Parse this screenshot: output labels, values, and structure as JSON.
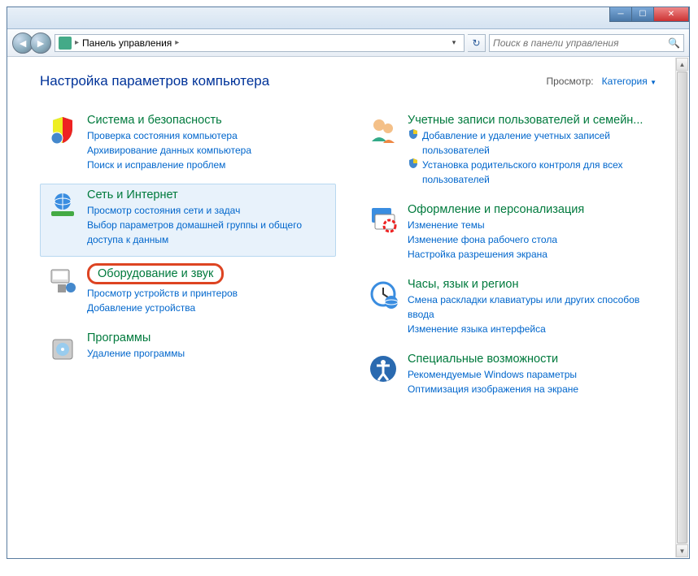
{
  "breadcrumb": {
    "root": "Панель управления"
  },
  "search": {
    "placeholder": "Поиск в панели управления"
  },
  "page_title": "Настройка параметров компьютера",
  "viewby": {
    "label": "Просмотр:",
    "value": "Категория"
  },
  "left": [
    {
      "title": "Система и безопасность",
      "links": [
        "Проверка состояния компьютера",
        "Архивирование данных компьютера",
        "Поиск и исправление проблем"
      ]
    },
    {
      "title": "Сеть и Интернет",
      "links": [
        "Просмотр состояния сети и задач",
        "Выбор параметров домашней группы и общего доступа к данным"
      ]
    },
    {
      "title": "Оборудование и звук",
      "links": [
        "Просмотр устройств и принтеров",
        "Добавление устройства"
      ]
    },
    {
      "title": "Программы",
      "links": [
        "Удаление программы"
      ]
    }
  ],
  "right": [
    {
      "title": "Учетные записи пользователей и семейн...",
      "links": [
        "Добавление и удаление учетных записей пользователей",
        "Установка родительского контроля для всех пользователей"
      ],
      "shields": [
        true,
        true
      ]
    },
    {
      "title": "Оформление и персонализация",
      "links": [
        "Изменение темы",
        "Изменение фона рабочего стола",
        "Настройка разрешения экрана"
      ]
    },
    {
      "title": "Часы, язык и регион",
      "links": [
        "Смена раскладки клавиатуры или других способов ввода",
        "Изменение языка интерфейса"
      ]
    },
    {
      "title": "Специальные возможности",
      "links": [
        "Рекомендуемые Windows параметры",
        "Оптимизация изображения на экране"
      ]
    }
  ]
}
